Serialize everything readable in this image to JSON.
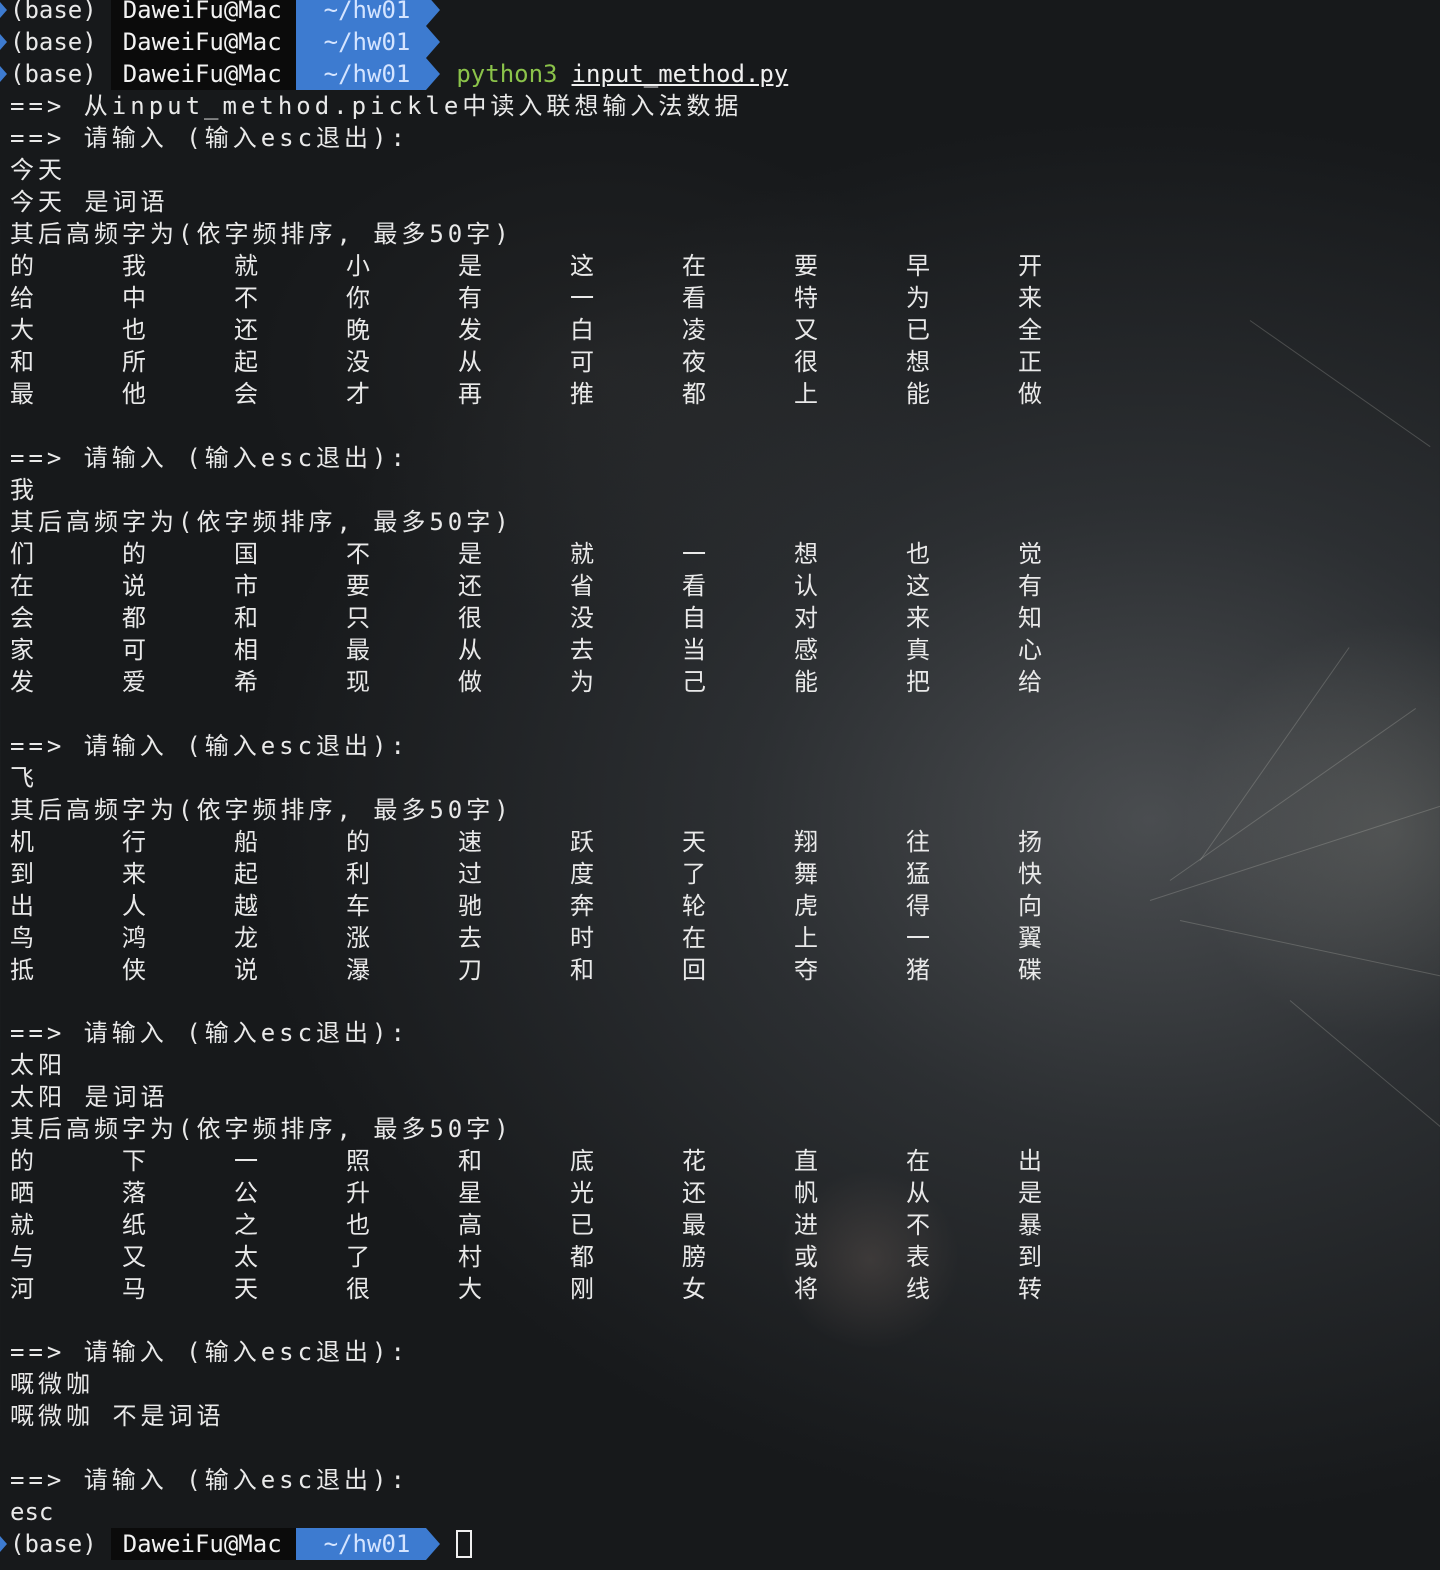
{
  "prompt": {
    "env": "(base)",
    "user": "DaweiFu@Mac",
    "dir": "~/hw01",
    "command": "python3",
    "argument": "input_method.py"
  },
  "output": {
    "load_msg": "==> 从input_method.pickle中读入联想输入法数据",
    "ask": "==> 请输入 (输入esc退出):",
    "follow_header": "其后高频字为(依字频排序, 最多50字)"
  },
  "sessions": [
    {
      "input": "今天",
      "result": "今天 是词语",
      "grid": [
        [
          "的",
          "我",
          "就",
          "小",
          "是",
          "这",
          "在",
          "要",
          "早",
          "开"
        ],
        [
          "给",
          "中",
          "不",
          "你",
          "有",
          "一",
          "看",
          "特",
          "为",
          "来"
        ],
        [
          "大",
          "也",
          "还",
          "晚",
          "发",
          "白",
          "凌",
          "又",
          "已",
          "全"
        ],
        [
          "和",
          "所",
          "起",
          "没",
          "从",
          "可",
          "夜",
          "很",
          "想",
          "正"
        ],
        [
          "最",
          "他",
          "会",
          "才",
          "再",
          "推",
          "都",
          "上",
          "能",
          "做"
        ]
      ]
    },
    {
      "input": "我",
      "result": "",
      "grid": [
        [
          "们",
          "的",
          "国",
          "不",
          "是",
          "就",
          "一",
          "想",
          "也",
          "觉"
        ],
        [
          "在",
          "说",
          "市",
          "要",
          "还",
          "省",
          "看",
          "认",
          "这",
          "有"
        ],
        [
          "会",
          "都",
          "和",
          "只",
          "很",
          "没",
          "自",
          "对",
          "来",
          "知"
        ],
        [
          "家",
          "可",
          "相",
          "最",
          "从",
          "去",
          "当",
          "感",
          "真",
          "心"
        ],
        [
          "发",
          "爱",
          "希",
          "现",
          "做",
          "为",
          "己",
          "能",
          "把",
          "给"
        ]
      ]
    },
    {
      "input": "飞",
      "result": "",
      "grid": [
        [
          "机",
          "行",
          "船",
          "的",
          "速",
          "跃",
          "天",
          "翔",
          "往",
          "扬"
        ],
        [
          "到",
          "来",
          "起",
          "利",
          "过",
          "度",
          "了",
          "舞",
          "猛",
          "快"
        ],
        [
          "出",
          "人",
          "越",
          "车",
          "驰",
          "奔",
          "轮",
          "虎",
          "得",
          "向"
        ],
        [
          "鸟",
          "鸿",
          "龙",
          "涨",
          "去",
          "时",
          "在",
          "上",
          "一",
          "翼"
        ],
        [
          "抵",
          "侠",
          "说",
          "瀑",
          "刀",
          "和",
          "回",
          "夺",
          "猪",
          "碟"
        ]
      ]
    },
    {
      "input": "太阳",
      "result": "太阳 是词语",
      "grid": [
        [
          "的",
          "下",
          "一",
          "照",
          "和",
          "底",
          "花",
          "直",
          "在",
          "出"
        ],
        [
          "晒",
          "落",
          "公",
          "升",
          "星",
          "光",
          "还",
          "帆",
          "从",
          "是"
        ],
        [
          "就",
          "纸",
          "之",
          "也",
          "高",
          "已",
          "最",
          "进",
          "不",
          "暴"
        ],
        [
          "与",
          "又",
          "太",
          "了",
          "村",
          "都",
          "膀",
          "或",
          "表",
          "到"
        ],
        [
          "河",
          "马",
          "天",
          "很",
          "大",
          "刚",
          "女",
          "将",
          "线",
          "转"
        ]
      ]
    },
    {
      "input": "嘅微咖",
      "result": "嘅微咖 不是词语"
    }
  ],
  "exit_input": "esc",
  "colors": {
    "dir_segment": "#3d7bd0",
    "user_segment": "#0b0b0b",
    "command": "#8bc34a"
  }
}
